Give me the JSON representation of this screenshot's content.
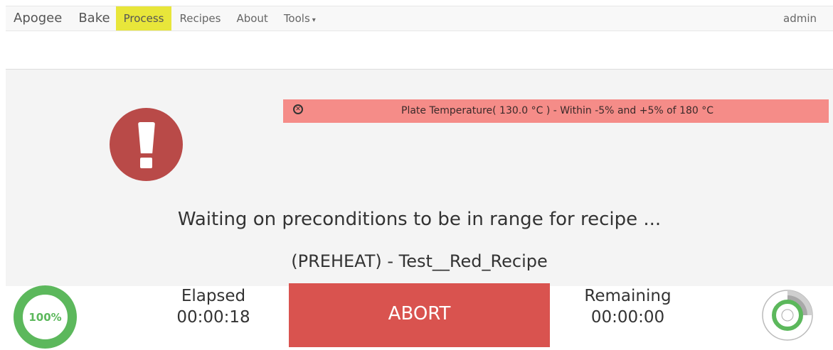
{
  "navbar": {
    "brand": "Apogee",
    "brand_secondary": "Bake",
    "items": [
      {
        "label": "Process",
        "active": true
      },
      {
        "label": "Recipes"
      },
      {
        "label": "About"
      },
      {
        "label": "Tools",
        "dropdown": true
      }
    ],
    "user": "admin",
    "accent_color": "#e8e63a"
  },
  "alert": {
    "text": "Plate Temperature( 130.0 °C ) - Within -5% and +5% of 180 °C",
    "icon": "circle-x-icon",
    "color": "#f58c88"
  },
  "status": {
    "icon": "exclamation-circle-icon",
    "message": "Waiting on preconditions to be in range for recipe ...",
    "recipe": "(PREHEAT) - Test__Red_Recipe"
  },
  "progress": {
    "label": "100%",
    "value": 1.0,
    "color": "#5cb85c"
  },
  "elapsed": {
    "label": "Elapsed",
    "value": "00:00:18"
  },
  "remaining": {
    "label": "Remaining",
    "value": "00:00:00"
  },
  "abort": {
    "label": "ABORT",
    "color": "#d9534f"
  },
  "gauge": {
    "icon": "stage-gauge-icon"
  }
}
